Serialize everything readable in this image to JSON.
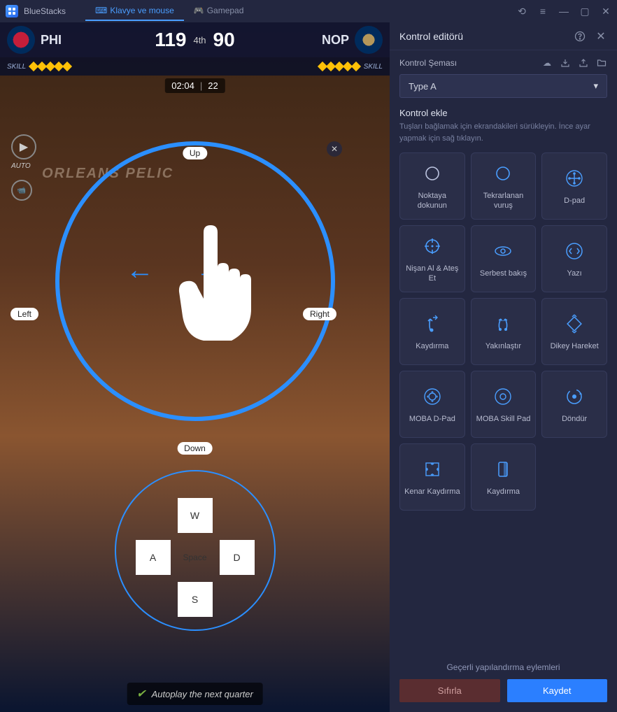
{
  "app": {
    "name": "BlueStacks"
  },
  "tabs": [
    {
      "label": "Klavye ve mouse",
      "active": true
    },
    {
      "label": "Gamepad",
      "active": false
    }
  ],
  "game": {
    "team_left": {
      "abbr": "PHI",
      "score": "119"
    },
    "team_right": {
      "abbr": "NOP",
      "score": "90"
    },
    "period": "4th",
    "skill_label_left": "SKILL",
    "skill_label_right": "SKILL",
    "clock": "02:04",
    "shot_clock": "22",
    "court_text": "ORLEANS PELIC",
    "auto_label": "AUTO",
    "autoplay_text": "Autoplay the next quarter"
  },
  "overlay": {
    "up": "Up",
    "down": "Down",
    "left": "Left",
    "right": "Right",
    "keys": {
      "w": "W",
      "a": "A",
      "s": "S",
      "d": "D",
      "space": "Space"
    }
  },
  "panel": {
    "title": "Kontrol editörü",
    "schema_label": "Kontrol Şeması",
    "schema_value": "Type A",
    "add_title": "Kontrol ekle",
    "add_desc": "Tuşları bağlamak için ekrandakileri sürükleyin. İnce ayar yapmak için sağ tıklayın.",
    "footer_label": "Geçerli yapılandırma eylemleri",
    "reset": "Sıfırla",
    "save": "Kaydet",
    "items": [
      {
        "label": "Noktaya dokunun",
        "icon": "tap"
      },
      {
        "label": "Tekrarlanan vuruş",
        "icon": "repeat"
      },
      {
        "label": "D-pad",
        "icon": "dpad"
      },
      {
        "label": "Nişan Al & Ateş Et",
        "icon": "aim"
      },
      {
        "label": "Serbest bakış",
        "icon": "freelook"
      },
      {
        "label": "Yazı",
        "icon": "script"
      },
      {
        "label": "Kaydırma",
        "icon": "swipe"
      },
      {
        "label": "Yakınlaştır",
        "icon": "zoom"
      },
      {
        "label": "Dikey Hareket",
        "icon": "tilt"
      },
      {
        "label": "MOBA D-Pad",
        "icon": "moba-dpad"
      },
      {
        "label": "MOBA Skill Pad",
        "icon": "moba-skill"
      },
      {
        "label": "Döndür",
        "icon": "rotate"
      },
      {
        "label": "Kenar Kaydırma",
        "icon": "edge-scroll"
      },
      {
        "label": "Kaydırma",
        "icon": "scroll"
      }
    ]
  }
}
